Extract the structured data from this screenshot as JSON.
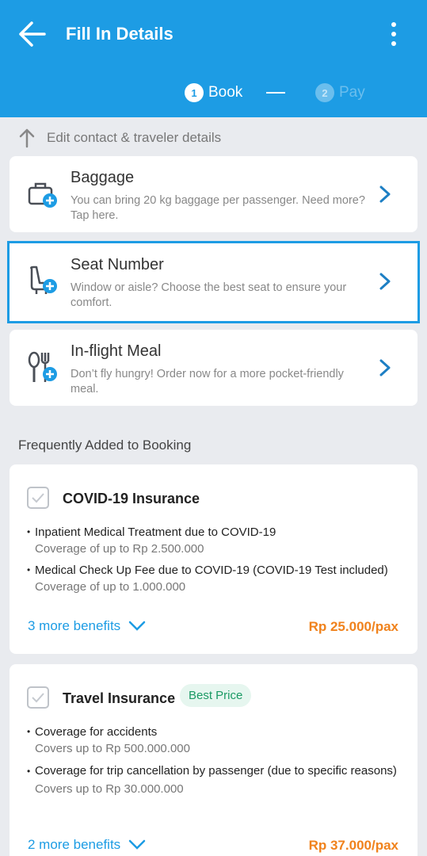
{
  "header": {
    "title": "Fill In Details",
    "steps": [
      {
        "number": "1",
        "label": "Book",
        "active": true
      },
      {
        "number": "2",
        "label": "Pay",
        "active": false
      }
    ],
    "accent_color": "#1d9ce4"
  },
  "edit_contact": {
    "label": "Edit contact & traveler details",
    "icon": "arrow-up-icon"
  },
  "addons": [
    {
      "title": "Baggage",
      "description": "You can bring 20 kg baggage per passenger. Need more? Tap here.",
      "icon": "baggage-add-icon",
      "selected": false
    },
    {
      "title": "Seat Number",
      "description": "Window or aisle? Choose the best seat to ensure your comfort.",
      "icon": "seat-add-icon",
      "selected": true
    },
    {
      "title": "In-flight Meal",
      "description": "Don’t fly hungry! Order now for a more pocket-friendly meal.",
      "icon": "meal-add-icon",
      "selected": false
    }
  ],
  "section_title": "Frequently Added to Booking",
  "insurances": [
    {
      "title": "COVID-19 Insurance",
      "badge": "",
      "checked": false,
      "benefits": [
        {
          "title": "Inpatient Medical Treatment due to COVID-19",
          "sub": "Coverage of up to Rp 2.500.000"
        },
        {
          "title": "Medical Check Up Fee due to COVID-19 (COVID-19 Test included)",
          "sub": "Coverage of up to 1.000.000"
        }
      ],
      "more_label": "3 more benefits",
      "price": "Rp 25.000/pax"
    },
    {
      "title": "Travel Insurance",
      "badge": "Best Price",
      "checked": false,
      "benefits": [
        {
          "title": "Coverage for accidents",
          "sub": "Covers up to Rp 500.000.000"
        },
        {
          "title": "Coverage for trip cancellation by passenger (due to specific reasons)",
          "sub": "Covers up to Rp 30.000.000"
        }
      ],
      "more_label": "2 more benefits",
      "price": "Rp 37.000/pax"
    }
  ]
}
